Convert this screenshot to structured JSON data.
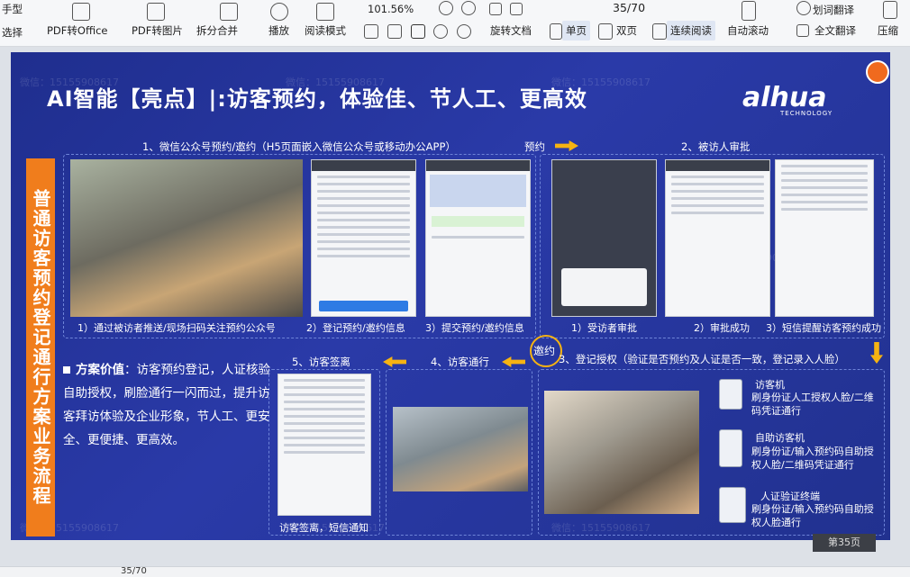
{
  "toolbar": {
    "hand_mode": "手型",
    "select": "选择",
    "pdf_to_office": "PDF转Office",
    "pdf_to_image": "PDF转图片",
    "split_merge": "拆分合并",
    "play": "播放",
    "read_mode": "阅读模式",
    "zoom": "101.56%",
    "page_indicator": "35/70",
    "rotate_doc": "旋转文档",
    "single_page": "单页",
    "double_page": "双页",
    "continuous_read": "连续阅读",
    "auto_scroll": "自动滚动",
    "word_translate": "划词翻译",
    "full_translate": "全文翻译",
    "compress": "压缩",
    "icons": [
      "hand-icon",
      "pdf-office-icon",
      "pdf-image-icon",
      "split-icon",
      "play-icon",
      "book-icon",
      "zoom-out-icon",
      "zoom-in-icon",
      "prev-page-icon",
      "next-page-icon",
      "fit-width-icon",
      "crop-icon",
      "select-area-icon",
      "rotate-left-icon",
      "rotate-right-icon",
      "single-page-icon",
      "double-page-icon",
      "continuous-icon",
      "auto-scroll-icon",
      "translate-icon",
      "full-translate-icon",
      "compress-icon"
    ]
  },
  "slide": {
    "title": "AI智能【亮点】|:访客预约，体验佳、节人工、更高效",
    "logo": "alhua",
    "logo_sub": "TECHNOLOGY",
    "vertical_label": "普通访客预约登记通行方案业务流程",
    "step1_title": "1、微信公众号预约/邀约（H5页面嵌入微信公众号或移动办公APP）",
    "reserve_label": "预约",
    "step2_title": "2、被访人审批",
    "caption_1_1": "1）通过被访者推送/现场扫码关注预约公众号",
    "caption_1_2": "2）登记预约/邀约信息",
    "caption_1_3": "3）提交预约/邀约信息",
    "caption_2_1": "1）受访者审批",
    "caption_2_2": "2）审批成功",
    "caption_2_3": "3）短信提醒访客预约成功",
    "invite_label": "邀约",
    "step3_title": "3、登记授权（验证是否预约及人证是否一致，登记录入人脸）",
    "step4_title": "4、访客通行",
    "step5_title": "5、访客签离",
    "caption_5": "访客签离，短信通知",
    "value_label": "方案价值",
    "value_text": "：访客预约登记，人证核验自助授权，刷脸通行一闪而过，提升访客拜访体验及企业形象，节人工、更安全、更便捷、更高效。",
    "device_1_title": "访客机",
    "device_1_desc": "刷身份证人工授权人脸/二维码凭证通行",
    "device_2_title": "自助访客机",
    "device_2_desc": "刷身份证/输入预约码自助授权人脸/二维码凭证通行",
    "device_3_title": "人证验证终端",
    "device_3_desc": "刷身份证/输入预约码自助授权人脸通行",
    "watermark": "微信：15155908617",
    "page_badge": "第35页"
  },
  "status": {
    "page_indicator": "35/70"
  },
  "colors": {
    "slide_bg": "#2a3aa8",
    "accent_orange": "#f07d1c",
    "arrow_yellow": "#f6b312",
    "dashed_border": "#6e84d8"
  }
}
